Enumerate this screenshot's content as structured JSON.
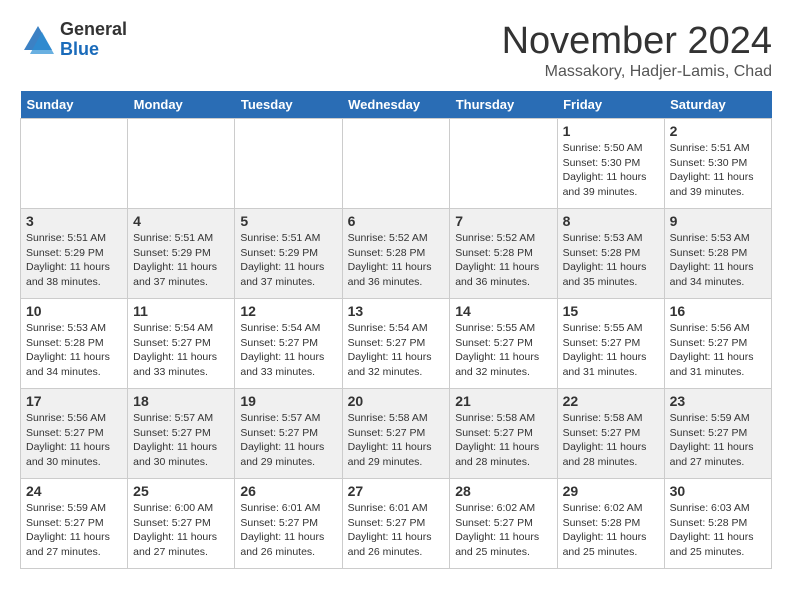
{
  "header": {
    "logo_general": "General",
    "logo_blue": "Blue",
    "month_title": "November 2024",
    "location": "Massakory, Hadjer-Lamis, Chad"
  },
  "calendar": {
    "days_of_week": [
      "Sunday",
      "Monday",
      "Tuesday",
      "Wednesday",
      "Thursday",
      "Friday",
      "Saturday"
    ],
    "weeks": [
      [
        {
          "day": "",
          "info": ""
        },
        {
          "day": "",
          "info": ""
        },
        {
          "day": "",
          "info": ""
        },
        {
          "day": "",
          "info": ""
        },
        {
          "day": "",
          "info": ""
        },
        {
          "day": "1",
          "info": "Sunrise: 5:50 AM\nSunset: 5:30 PM\nDaylight: 11 hours\nand 39 minutes."
        },
        {
          "day": "2",
          "info": "Sunrise: 5:51 AM\nSunset: 5:30 PM\nDaylight: 11 hours\nand 39 minutes."
        }
      ],
      [
        {
          "day": "3",
          "info": "Sunrise: 5:51 AM\nSunset: 5:29 PM\nDaylight: 11 hours\nand 38 minutes."
        },
        {
          "day": "4",
          "info": "Sunrise: 5:51 AM\nSunset: 5:29 PM\nDaylight: 11 hours\nand 37 minutes."
        },
        {
          "day": "5",
          "info": "Sunrise: 5:51 AM\nSunset: 5:29 PM\nDaylight: 11 hours\nand 37 minutes."
        },
        {
          "day": "6",
          "info": "Sunrise: 5:52 AM\nSunset: 5:28 PM\nDaylight: 11 hours\nand 36 minutes."
        },
        {
          "day": "7",
          "info": "Sunrise: 5:52 AM\nSunset: 5:28 PM\nDaylight: 11 hours\nand 36 minutes."
        },
        {
          "day": "8",
          "info": "Sunrise: 5:53 AM\nSunset: 5:28 PM\nDaylight: 11 hours\nand 35 minutes."
        },
        {
          "day": "9",
          "info": "Sunrise: 5:53 AM\nSunset: 5:28 PM\nDaylight: 11 hours\nand 34 minutes."
        }
      ],
      [
        {
          "day": "10",
          "info": "Sunrise: 5:53 AM\nSunset: 5:28 PM\nDaylight: 11 hours\nand 34 minutes."
        },
        {
          "day": "11",
          "info": "Sunrise: 5:54 AM\nSunset: 5:27 PM\nDaylight: 11 hours\nand 33 minutes."
        },
        {
          "day": "12",
          "info": "Sunrise: 5:54 AM\nSunset: 5:27 PM\nDaylight: 11 hours\nand 33 minutes."
        },
        {
          "day": "13",
          "info": "Sunrise: 5:54 AM\nSunset: 5:27 PM\nDaylight: 11 hours\nand 32 minutes."
        },
        {
          "day": "14",
          "info": "Sunrise: 5:55 AM\nSunset: 5:27 PM\nDaylight: 11 hours\nand 32 minutes."
        },
        {
          "day": "15",
          "info": "Sunrise: 5:55 AM\nSunset: 5:27 PM\nDaylight: 11 hours\nand 31 minutes."
        },
        {
          "day": "16",
          "info": "Sunrise: 5:56 AM\nSunset: 5:27 PM\nDaylight: 11 hours\nand 31 minutes."
        }
      ],
      [
        {
          "day": "17",
          "info": "Sunrise: 5:56 AM\nSunset: 5:27 PM\nDaylight: 11 hours\nand 30 minutes."
        },
        {
          "day": "18",
          "info": "Sunrise: 5:57 AM\nSunset: 5:27 PM\nDaylight: 11 hours\nand 30 minutes."
        },
        {
          "day": "19",
          "info": "Sunrise: 5:57 AM\nSunset: 5:27 PM\nDaylight: 11 hours\nand 29 minutes."
        },
        {
          "day": "20",
          "info": "Sunrise: 5:58 AM\nSunset: 5:27 PM\nDaylight: 11 hours\nand 29 minutes."
        },
        {
          "day": "21",
          "info": "Sunrise: 5:58 AM\nSunset: 5:27 PM\nDaylight: 11 hours\nand 28 minutes."
        },
        {
          "day": "22",
          "info": "Sunrise: 5:58 AM\nSunset: 5:27 PM\nDaylight: 11 hours\nand 28 minutes."
        },
        {
          "day": "23",
          "info": "Sunrise: 5:59 AM\nSunset: 5:27 PM\nDaylight: 11 hours\nand 27 minutes."
        }
      ],
      [
        {
          "day": "24",
          "info": "Sunrise: 5:59 AM\nSunset: 5:27 PM\nDaylight: 11 hours\nand 27 minutes."
        },
        {
          "day": "25",
          "info": "Sunrise: 6:00 AM\nSunset: 5:27 PM\nDaylight: 11 hours\nand 27 minutes."
        },
        {
          "day": "26",
          "info": "Sunrise: 6:01 AM\nSunset: 5:27 PM\nDaylight: 11 hours\nand 26 minutes."
        },
        {
          "day": "27",
          "info": "Sunrise: 6:01 AM\nSunset: 5:27 PM\nDaylight: 11 hours\nand 26 minutes."
        },
        {
          "day": "28",
          "info": "Sunrise: 6:02 AM\nSunset: 5:27 PM\nDaylight: 11 hours\nand 25 minutes."
        },
        {
          "day": "29",
          "info": "Sunrise: 6:02 AM\nSunset: 5:28 PM\nDaylight: 11 hours\nand 25 minutes."
        },
        {
          "day": "30",
          "info": "Sunrise: 6:03 AM\nSunset: 5:28 PM\nDaylight: 11 hours\nand 25 minutes."
        }
      ]
    ]
  }
}
